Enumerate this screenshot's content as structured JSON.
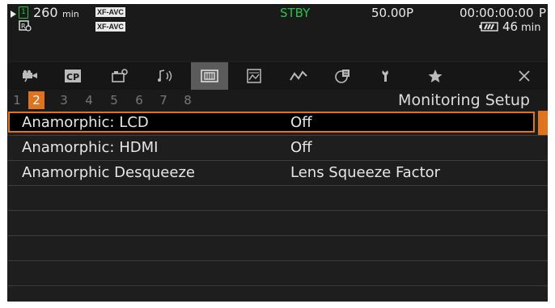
{
  "status": {
    "card_slot": "1",
    "time_remaining": "260",
    "time_unit": "min",
    "format_a": "XF-AVC",
    "format_b": "XF-AVC",
    "record_status": "STBY",
    "frame_rate": "50.00P",
    "timecode": "00:00:00:00",
    "timecode_suffix": "P",
    "battery_minutes": "46",
    "battery_unit": "min"
  },
  "tabs": [
    {
      "icon": "camera-icon",
      "active": false
    },
    {
      "icon": "cp-icon",
      "active": false
    },
    {
      "icon": "camera-settings-icon",
      "active": false
    },
    {
      "icon": "audio-icon",
      "active": false
    },
    {
      "icon": "monitoring-icon",
      "active": true
    },
    {
      "icon": "recording-media-icon",
      "active": false
    },
    {
      "icon": "waveform-icon",
      "active": false
    },
    {
      "icon": "playback-icon",
      "active": false
    },
    {
      "icon": "wrench-icon",
      "active": false
    },
    {
      "icon": "star-icon",
      "active": false
    },
    {
      "icon": "close-icon",
      "active": false
    }
  ],
  "pages": {
    "numbers": [
      "1",
      "2",
      "3",
      "4",
      "5",
      "6",
      "7",
      "8"
    ],
    "current": "2",
    "title": "Monitoring Setup"
  },
  "menu": {
    "items": [
      {
        "label": "Anamorphic: LCD",
        "value": "Off",
        "selected": true
      },
      {
        "label": "Anamorphic: HDMI",
        "value": "Off",
        "selected": false
      },
      {
        "label": "Anamorphic Desqueeze",
        "value": "Lens Squeeze Factor",
        "selected": false
      },
      {
        "label": "",
        "value": "",
        "selected": false
      },
      {
        "label": "",
        "value": "",
        "selected": false
      },
      {
        "label": "",
        "value": "",
        "selected": false
      },
      {
        "label": "",
        "value": "",
        "selected": false
      },
      {
        "label": "",
        "value": "",
        "selected": false
      }
    ]
  },
  "colors": {
    "accent": "#e0731e",
    "standby": "#25c24a",
    "background": "#1e1e1e"
  }
}
